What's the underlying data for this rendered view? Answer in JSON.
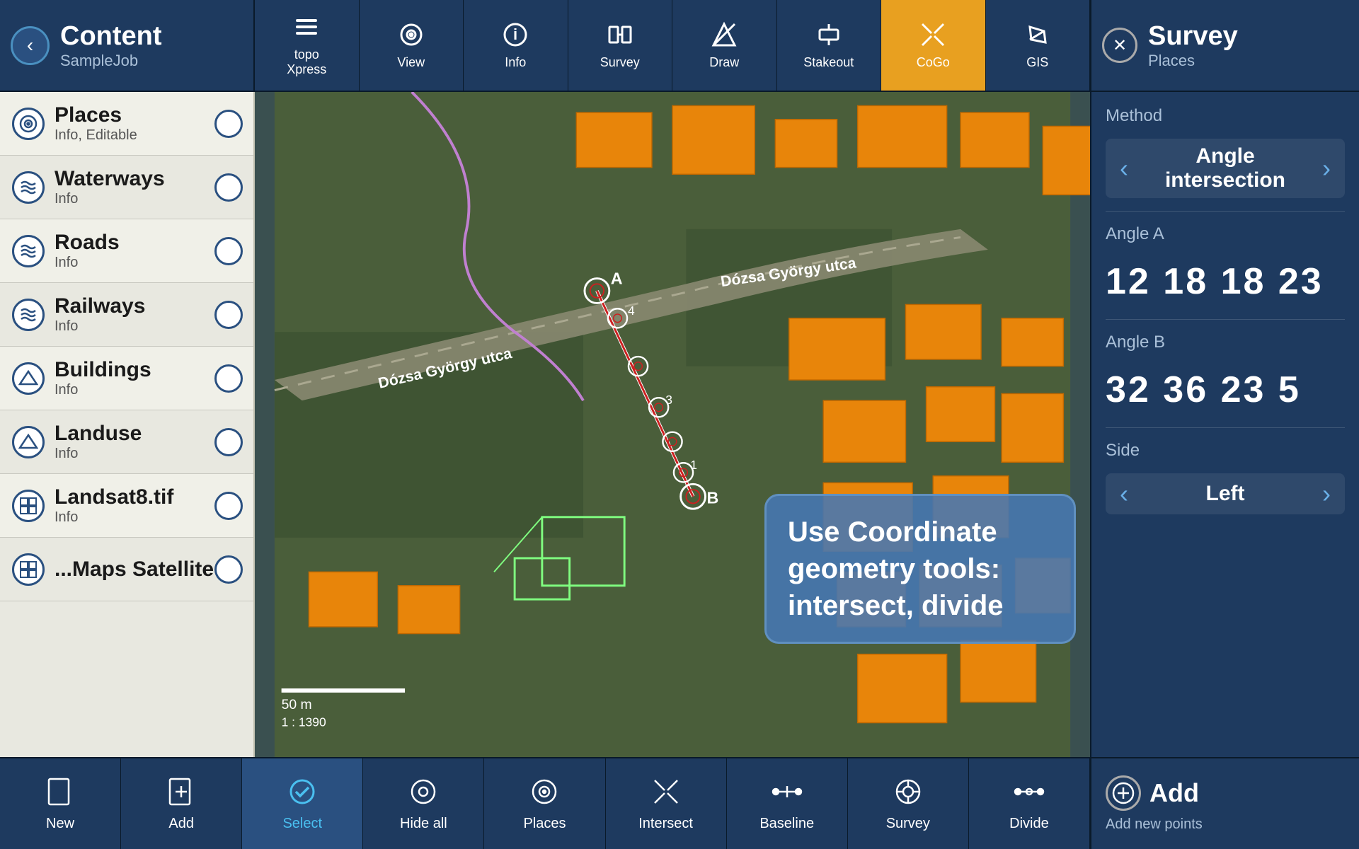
{
  "header": {
    "back_label": "‹",
    "title": "Content",
    "subtitle": "SampleJob",
    "survey_close": "✕",
    "survey_title": "Survey",
    "survey_sub": "Places"
  },
  "toolbar": {
    "items": [
      {
        "id": "topo",
        "icon": "≡",
        "label": "topo\nXpress"
      },
      {
        "id": "view",
        "icon": "◎",
        "label": "View"
      },
      {
        "id": "info",
        "icon": "ⓘ",
        "label": "Info"
      },
      {
        "id": "survey",
        "icon": "⊣⊢",
        "label": "Survey"
      },
      {
        "id": "draw",
        "icon": "⊘",
        "label": "Draw"
      },
      {
        "id": "stakeout",
        "icon": "⊓",
        "label": "Stakeout"
      },
      {
        "id": "cogo",
        "icon": "✕",
        "label": "CoGo"
      },
      {
        "id": "gis",
        "icon": "✎",
        "label": "GIS"
      }
    ]
  },
  "sidebar": {
    "items": [
      {
        "id": "places",
        "icon": "◉",
        "name": "Places",
        "sub": "Info, Editable"
      },
      {
        "id": "waterways",
        "icon": "∿",
        "name": "Waterways",
        "sub": "Info"
      },
      {
        "id": "roads",
        "icon": "∿",
        "name": "Roads",
        "sub": "Info"
      },
      {
        "id": "railways",
        "icon": "∿",
        "name": "Railways",
        "sub": "Info"
      },
      {
        "id": "buildings",
        "icon": "∧",
        "name": "Buildings",
        "sub": "Info"
      },
      {
        "id": "landuse",
        "icon": "∧",
        "name": "Landuse",
        "sub": "Info"
      },
      {
        "id": "landsat",
        "icon": "⊞",
        "name": "Landsat8.tif",
        "sub": "Info"
      },
      {
        "id": "maps",
        "icon": "⊞",
        "name": "...Maps Satellite",
        "sub": ""
      }
    ]
  },
  "map": {
    "tooltip": "Use Coordinate geometry tools: intersect, divide",
    "scale_bar": "50 m",
    "scale_ratio": "1 : 1390",
    "road_label": "Dózsa György utca"
  },
  "right_panel": {
    "method_label": "Method",
    "method_value": "Angle intersection",
    "angle_a_label": "Angle A",
    "angle_a_value": "12 18 18 23",
    "angle_b_label": "Angle B",
    "angle_b_value": "32 36 23 5",
    "side_label": "Side",
    "side_value": "Left"
  },
  "bottom": {
    "items": [
      {
        "id": "new",
        "icon": "☐",
        "label": "New"
      },
      {
        "id": "add",
        "icon": "⊕",
        "label": "Add"
      },
      {
        "id": "select",
        "icon": "✓",
        "label": "Select",
        "active": true
      },
      {
        "id": "hide_all",
        "icon": "◎",
        "label": "Hide all"
      },
      {
        "id": "places_b",
        "icon": "◎",
        "label": "Places"
      },
      {
        "id": "intersect",
        "icon": "✕",
        "label": "Intersect"
      },
      {
        "id": "baseline",
        "icon": "⊸",
        "label": "Baseline"
      },
      {
        "id": "survey_b",
        "icon": "◎",
        "label": "Survey"
      },
      {
        "id": "divide",
        "icon": "⊸",
        "label": "Divide"
      }
    ],
    "add_label": "Add",
    "add_sub": "Add new points"
  },
  "colors": {
    "accent": "#e8a020",
    "active_tab": "#e8a020",
    "bg_dark": "#1e3a5f",
    "building_fill": "#e8850a",
    "tooltip_bg": "rgba(70,120,180,0.88)"
  }
}
